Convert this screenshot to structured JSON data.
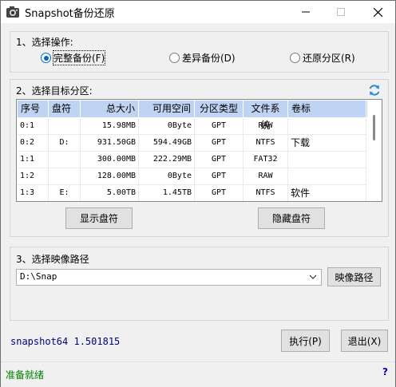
{
  "window": {
    "title": "Snapshot备份还原",
    "controls": {
      "minimize": "minimize-icon",
      "maximize": "maximize-icon",
      "close": "close-icon"
    }
  },
  "section1": {
    "label": "1、选择操作:",
    "options": [
      {
        "label": "完整备份(F)",
        "selected": true
      },
      {
        "label": "差异备份(D)",
        "selected": false
      },
      {
        "label": "还原分区(R)",
        "selected": false
      }
    ]
  },
  "section2": {
    "label": "2、选择目标分区:",
    "refresh_icon": "refresh-icon",
    "columns": [
      "序号",
      "盘符",
      "总大小",
      "可用空间",
      "分区类型",
      "文件系统",
      "卷标"
    ],
    "rows": [
      [
        "0:1",
        "",
        "15.98MB",
        "0Byte",
        "GPT",
        "RAW",
        ""
      ],
      [
        "0:2",
        "D:",
        "931.50GB",
        "594.49GB",
        "GPT",
        "NTFS",
        "下载"
      ],
      [
        "1:1",
        "",
        "300.00MB",
        "222.29MB",
        "GPT",
        "FAT32",
        ""
      ],
      [
        "1:2",
        "",
        "128.00MB",
        "0Byte",
        "GPT",
        "RAW",
        ""
      ],
      [
        "1:3",
        "E:",
        "5.00TB",
        "1.45TB",
        "GPT",
        "NTFS",
        "软件"
      ]
    ],
    "show_button": "显示盘符",
    "hide_button": "隐藏盘符"
  },
  "section3": {
    "label": "3、选择映像路径",
    "path_value": "D:\\Snap",
    "browse_button": "映像路径"
  },
  "footer": {
    "version": "snapshot64 1.501815",
    "execute_button": "执行(P)",
    "exit_button": "退出(X)"
  },
  "status": {
    "text": "准备就绪",
    "help": "?"
  },
  "colors": {
    "header_bg": "#bfd3f2",
    "accent": "#0067c0",
    "version_text": "#000080",
    "status_text": "#008000"
  }
}
